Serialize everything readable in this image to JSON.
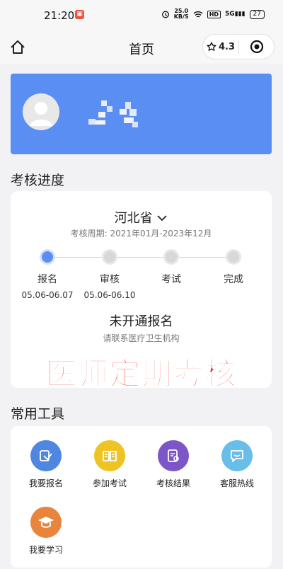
{
  "status_bar": {
    "time": "21:20",
    "speed_top": "25.0",
    "speed_bottom": "KB/S",
    "hd": "HD",
    "network": "5G",
    "battery": "27"
  },
  "nav": {
    "title": "首页",
    "rating": "4.3"
  },
  "section_progress": {
    "title": "考核进度"
  },
  "progress": {
    "province": "河北省",
    "period_label": "考核周期:",
    "period_value": "2021年01月-2023年12月",
    "steps": [
      {
        "label": "报名",
        "date": "05.06-06.07",
        "active": true
      },
      {
        "label": "审核",
        "date": "05.06-06.10",
        "active": false
      },
      {
        "label": "考试",
        "date": "",
        "active": false
      },
      {
        "label": "完成",
        "date": "",
        "active": false
      }
    ],
    "status": "未开通报名",
    "status_hint": "请联系医疗卫生机构"
  },
  "overlay_caption": "医师定期考核",
  "section_tools": {
    "title": "常用工具"
  },
  "tools": [
    {
      "label": "我要报名",
      "icon": "signup-icon",
      "color": "#4f86e0"
    },
    {
      "label": "参加考试",
      "icon": "book-icon",
      "color": "#eec323"
    },
    {
      "label": "考核结果",
      "icon": "result-icon",
      "color": "#7c56c9"
    },
    {
      "label": "客服热线",
      "icon": "chat-icon",
      "color": "#68bde9"
    },
    {
      "label": "我要学习",
      "icon": "graduation-cap-icon",
      "color": "#e9843d"
    }
  ],
  "colors": {
    "banner": "#5b8ef3",
    "accent": "#5b8ef3",
    "overlay_text": "#ee2a1f"
  }
}
